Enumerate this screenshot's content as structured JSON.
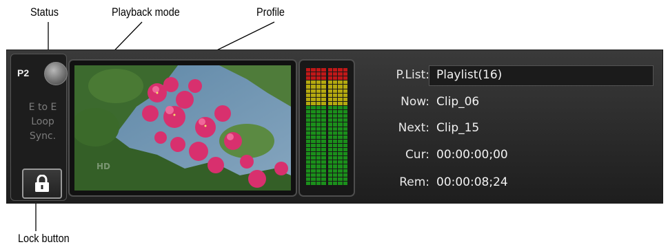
{
  "callouts": {
    "status": "Status",
    "playback_mode": "Playback mode",
    "profile": "Profile",
    "lock_button": "Lock button"
  },
  "channel": {
    "name": "P2",
    "status_indicator_color": "#8a8a8a"
  },
  "playback_modes": [
    "E to E",
    "Loop",
    "Sync."
  ],
  "lock_icon": "padlock-icon",
  "video_badge": "HD",
  "audio_meter": {
    "colors": {
      "green": "#1b8f1b",
      "yellow": "#b5a90f",
      "red": "#c01818"
    }
  },
  "info": {
    "playlist_label": "P.List:",
    "playlist_value": "Playlist(16)",
    "now_label": "Now:",
    "now_value": "Clip_06",
    "next_label": "Next:",
    "next_value": "Clip_15",
    "cur_label": "Cur:",
    "cur_value": "00:00:00;00",
    "rem_label": "Rem:",
    "rem_value": "00:00:08;24"
  }
}
